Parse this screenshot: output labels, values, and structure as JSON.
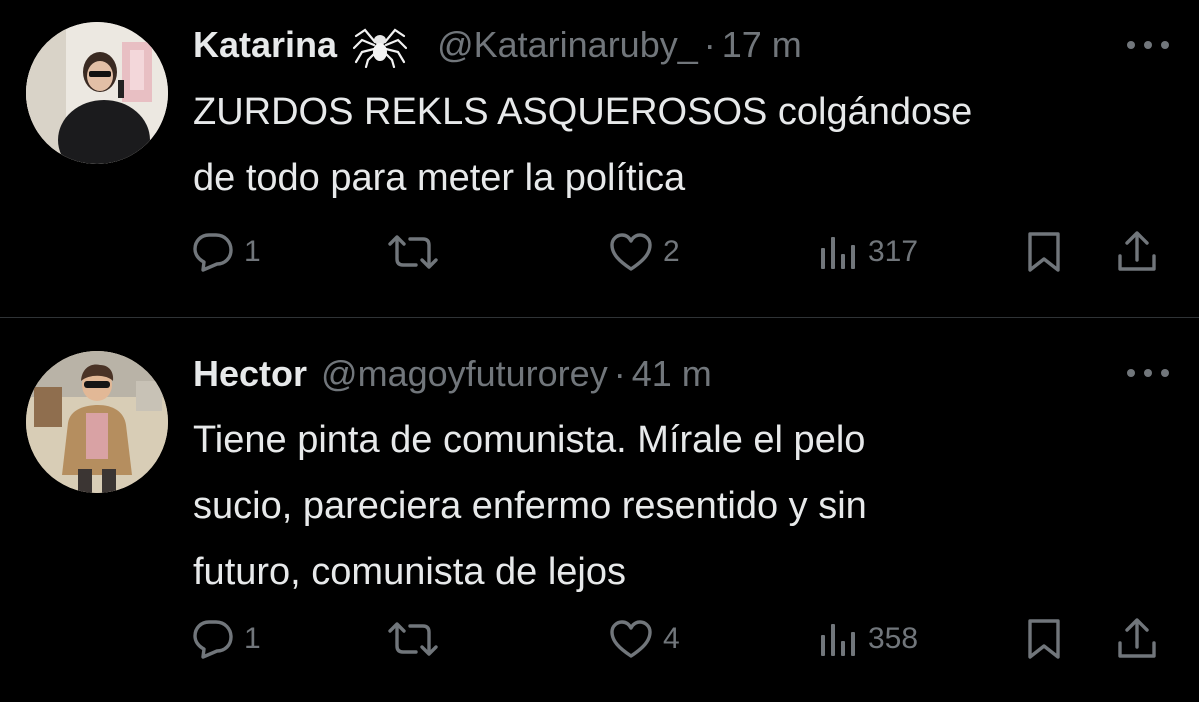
{
  "tweets": [
    {
      "name": "Katarina",
      "name_emoji": "spider",
      "handle": "@Katarinaruby_",
      "separator": "·",
      "time": "17 m",
      "text": "ZURDOS REKLS ASQUEROSOS colgándose\nde todo para meter la política",
      "replies": "1",
      "retweets": "",
      "likes": "2",
      "views": "317"
    },
    {
      "name": "Hector",
      "handle": "@magoyfuturorey",
      "separator": "·",
      "time": "41 m",
      "text": "Tiene pinta de comunista. Mírale el pelo\nsucio, pareciera enfermo resentido y sin\nfuturo, comunista de lejos",
      "replies": "1",
      "retweets": "",
      "likes": "4",
      "views": "358"
    }
  ],
  "icons": {
    "reply": "comment-icon",
    "retweet": "retweet-icon",
    "like": "heart-icon",
    "views": "bar-chart-icon",
    "bookmark": "bookmark-icon",
    "share": "share-icon",
    "more": "more-dots-icon"
  },
  "colors": {
    "background": "#000000",
    "primary_text": "#e7e9ea",
    "secondary_text": "#71767b",
    "divider": "#2f3336"
  }
}
